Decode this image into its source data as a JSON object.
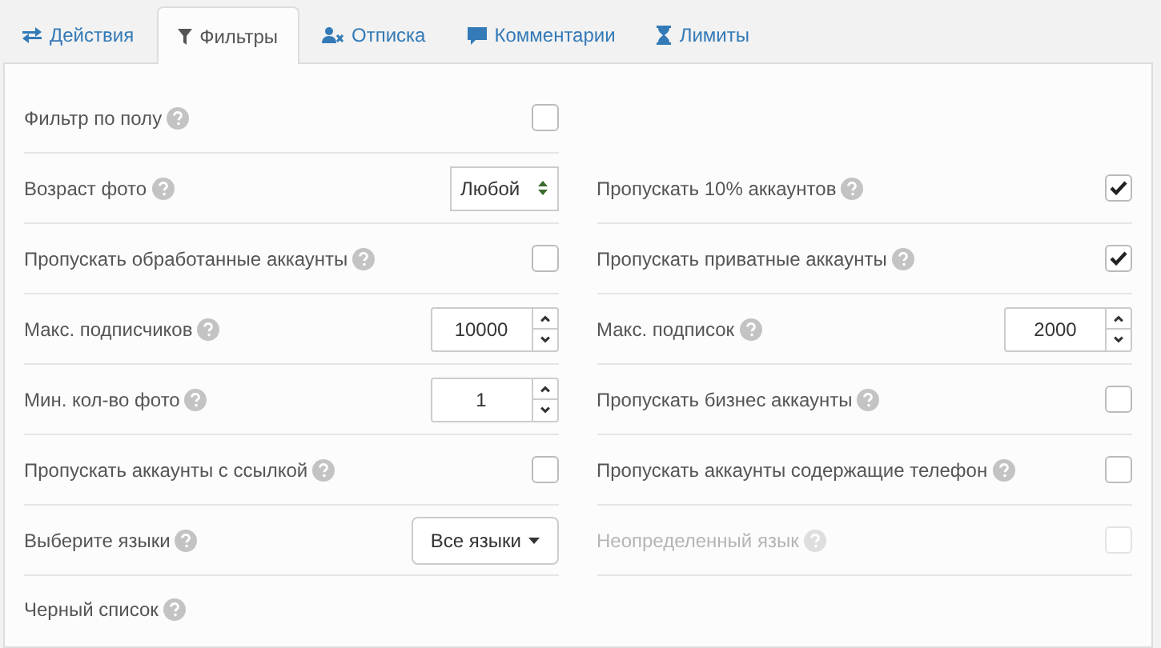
{
  "tabs": [
    {
      "label": "Действия",
      "selected": false
    },
    {
      "label": "Фильтры",
      "selected": true
    },
    {
      "label": "Отписка",
      "selected": false
    },
    {
      "label": "Комментарии",
      "selected": false
    },
    {
      "label": "Лимиты",
      "selected": false
    }
  ],
  "left_column": [
    {
      "kind": "checkbox",
      "label": "Фильтр по полу",
      "checked": false,
      "disabled": false
    },
    {
      "kind": "select",
      "label": "Возраст фото",
      "value": "Любой",
      "disabled": false
    },
    {
      "kind": "checkbox",
      "label": "Пропускать обработанные аккаунты",
      "checked": false,
      "disabled": false
    },
    {
      "kind": "number",
      "label": "Макс. подписчиков",
      "value": "10000",
      "disabled": false
    },
    {
      "kind": "number",
      "label": "Мин. кол-во фото",
      "value": "1",
      "disabled": false
    },
    {
      "kind": "checkbox",
      "label": "Пропускать аккаунты с ссылкой",
      "checked": false,
      "disabled": false
    },
    {
      "kind": "dropdown",
      "label": "Выберите языки",
      "value": "Все языки",
      "disabled": false
    }
  ],
  "right_column": [
    {
      "kind": "checkbox",
      "label": "Пропускать 10% аккаунтов",
      "checked": true,
      "disabled": false
    },
    {
      "kind": "checkbox",
      "label": "Пропускать приватные аккаунты",
      "checked": true,
      "disabled": false
    },
    {
      "kind": "number",
      "label": "Макс. подписок",
      "value": "2000",
      "disabled": false
    },
    {
      "kind": "checkbox",
      "label": "Пропускать бизнес аккаунты",
      "checked": false,
      "disabled": false
    },
    {
      "kind": "checkbox",
      "label": "Пропускать аккаунты содержащие телефон",
      "checked": false,
      "disabled": false
    },
    {
      "kind": "checkbox",
      "label": "Неопределенный язык",
      "checked": false,
      "disabled": true
    }
  ],
  "footer_item": {
    "label": "Черный список"
  }
}
